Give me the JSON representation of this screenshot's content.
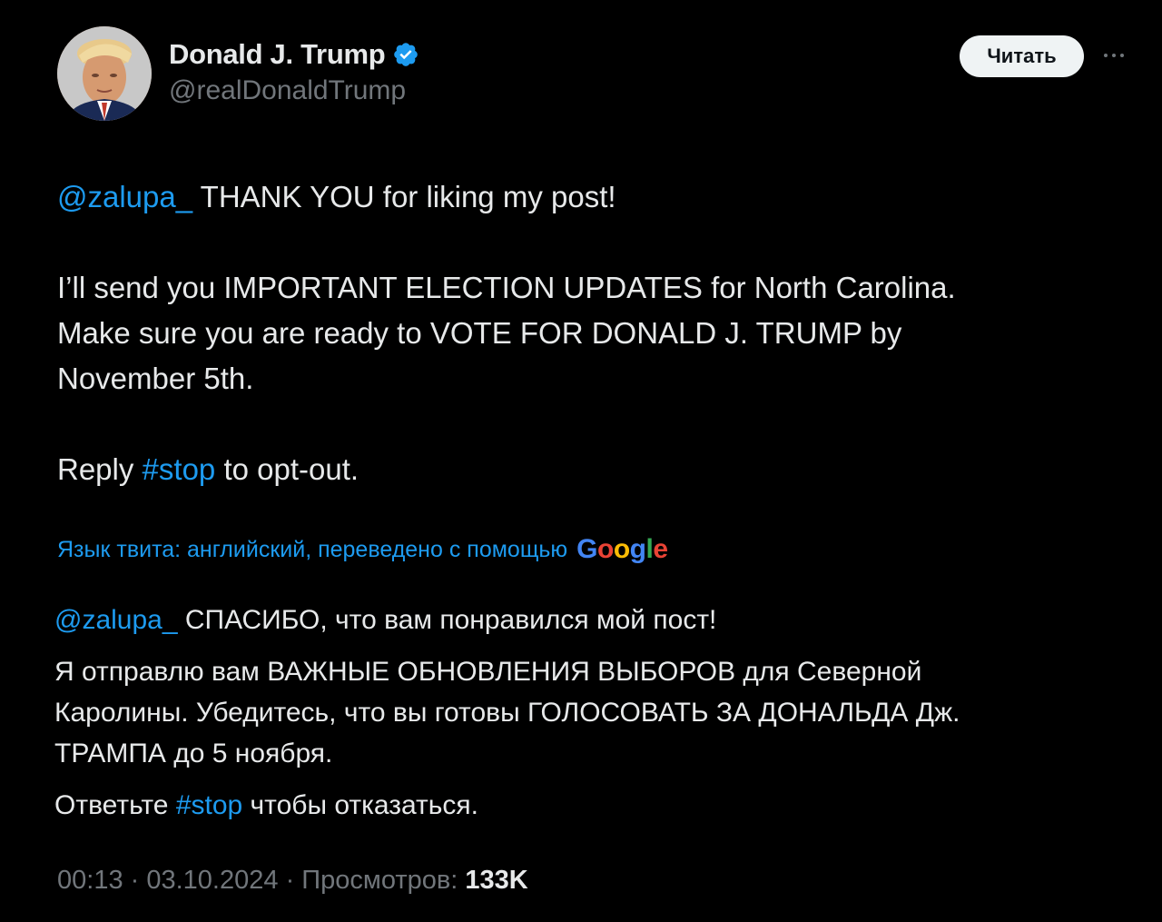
{
  "author": {
    "display_name": "Donald J. Trump",
    "handle": "@realDonaldTrump",
    "verified": true,
    "verified_color": "#1d9bf0"
  },
  "header": {
    "follow_label": "Читать",
    "more_icon": "more-horizontal-icon"
  },
  "original": {
    "mention": "@zalupa_",
    "line1_rest": " THANK YOU for liking my post!",
    "line2": "I’ll send you IMPORTANT ELECTION UPDATES for North Carolina.",
    "line3": "Make sure you are ready to VOTE FOR DONALD J. TRUMP by",
    "line4": "November 5th.",
    "reply_prefix": "Reply ",
    "hashtag": "#stop",
    "reply_suffix": " to opt-out."
  },
  "translation_note": {
    "text": "Язык твита: английский, переведено с помощью",
    "provider": "Google"
  },
  "translated": {
    "mention": "@zalupa_",
    "line1_rest": " СПАСИБО, что вам понравился мой пост!",
    "line2": "Я отправлю вам ВАЖНЫЕ ОБНОВЛЕНИЯ ВЫБОРОВ для Северной",
    "line3": "Каролины. Убедитесь, что вы готовы ГОЛОСОВАТЬ ЗА ДОНАЛЬДА Дж.",
    "line4": "ТРАМПА до 5 ноября.",
    "reply_prefix": "Ответьте ",
    "hashtag": "#stop",
    "reply_suffix": " чтобы отказаться."
  },
  "meta": {
    "time": "00:13",
    "date": "03.10.2024",
    "views_label": "Просмотров:",
    "views_count": "133K"
  },
  "colors": {
    "background": "#000000",
    "text": "#e7e9ea",
    "secondary": "#71767b",
    "link": "#1d9bf0"
  }
}
